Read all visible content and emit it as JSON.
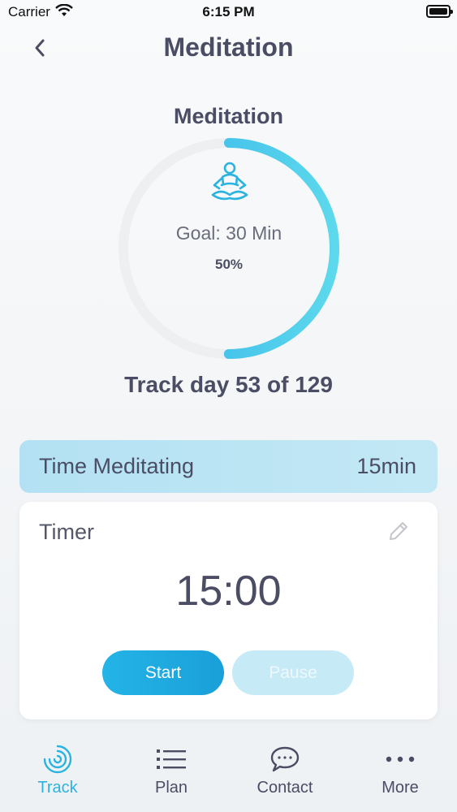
{
  "status_bar": {
    "carrier": "Carrier",
    "time": "6:15 PM"
  },
  "header": {
    "title": "Meditation"
  },
  "progress": {
    "title": "Meditation",
    "goal": "Goal: 30 Min",
    "percent_label": "50%",
    "fraction": 0.5,
    "track_day": "Track day 53 of 129"
  },
  "time_meditating": {
    "label": "Time Meditating",
    "value": "15min"
  },
  "timer": {
    "label": "Timer",
    "value": "15:00",
    "start_label": "Start",
    "pause_label": "Pause"
  },
  "tabs": [
    {
      "label": "Track",
      "icon": "track-icon",
      "active": true
    },
    {
      "label": "Plan",
      "icon": "list-icon",
      "active": false
    },
    {
      "label": "Contact",
      "icon": "chat-bubble-icon",
      "active": false
    },
    {
      "label": "More",
      "icon": "more-dots-icon",
      "active": false
    }
  ],
  "colors": {
    "accent": "#2bb3e0",
    "ring_track": "#eeeff1",
    "text": "#4a4d63"
  }
}
